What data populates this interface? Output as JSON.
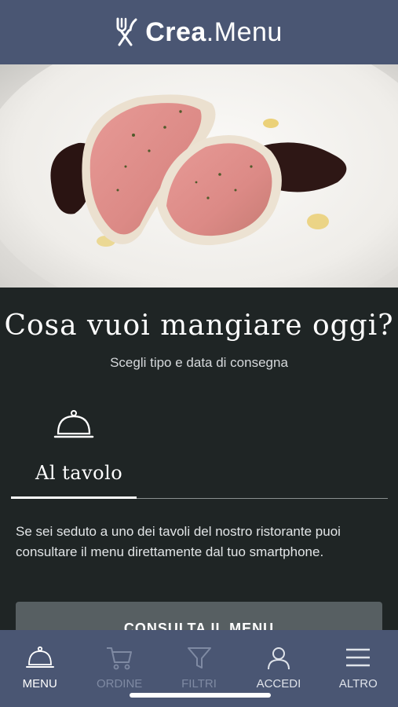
{
  "header": {
    "logo_bold": "Crea",
    "logo_light": ".Menu",
    "logo_icon": "fork-knife-icon"
  },
  "hero": {
    "image_icon": "sliced-meat-plate-image"
  },
  "main": {
    "title": "Cosa vuoi mangiare oggi?",
    "subtitle": "Scegli tipo e data di consegna",
    "tabs": [
      {
        "label": "Al tavolo",
        "icon": "cloche-icon",
        "active": true
      }
    ],
    "description": "Se sei seduto a uno dei tavoli del nostro ristorante puoi consultare il menu direttamente dal tuo smartphone.",
    "cta_label": "CONSULTA IL MENU"
  },
  "bottom_nav": {
    "items": [
      {
        "label": "MENU",
        "icon": "cloche-icon",
        "state": "active"
      },
      {
        "label": "ORDINE",
        "icon": "cart-icon",
        "state": "disabled"
      },
      {
        "label": "FILTRI",
        "icon": "filter-icon",
        "state": "disabled"
      },
      {
        "label": "ACCEDI",
        "icon": "user-icon",
        "state": "normal"
      },
      {
        "label": "ALTRO",
        "icon": "hamburger-icon",
        "state": "normal"
      }
    ]
  },
  "colors": {
    "header_bg": "#4a5673",
    "content_bg": "#1f2525",
    "button_bg": "#575f62"
  }
}
